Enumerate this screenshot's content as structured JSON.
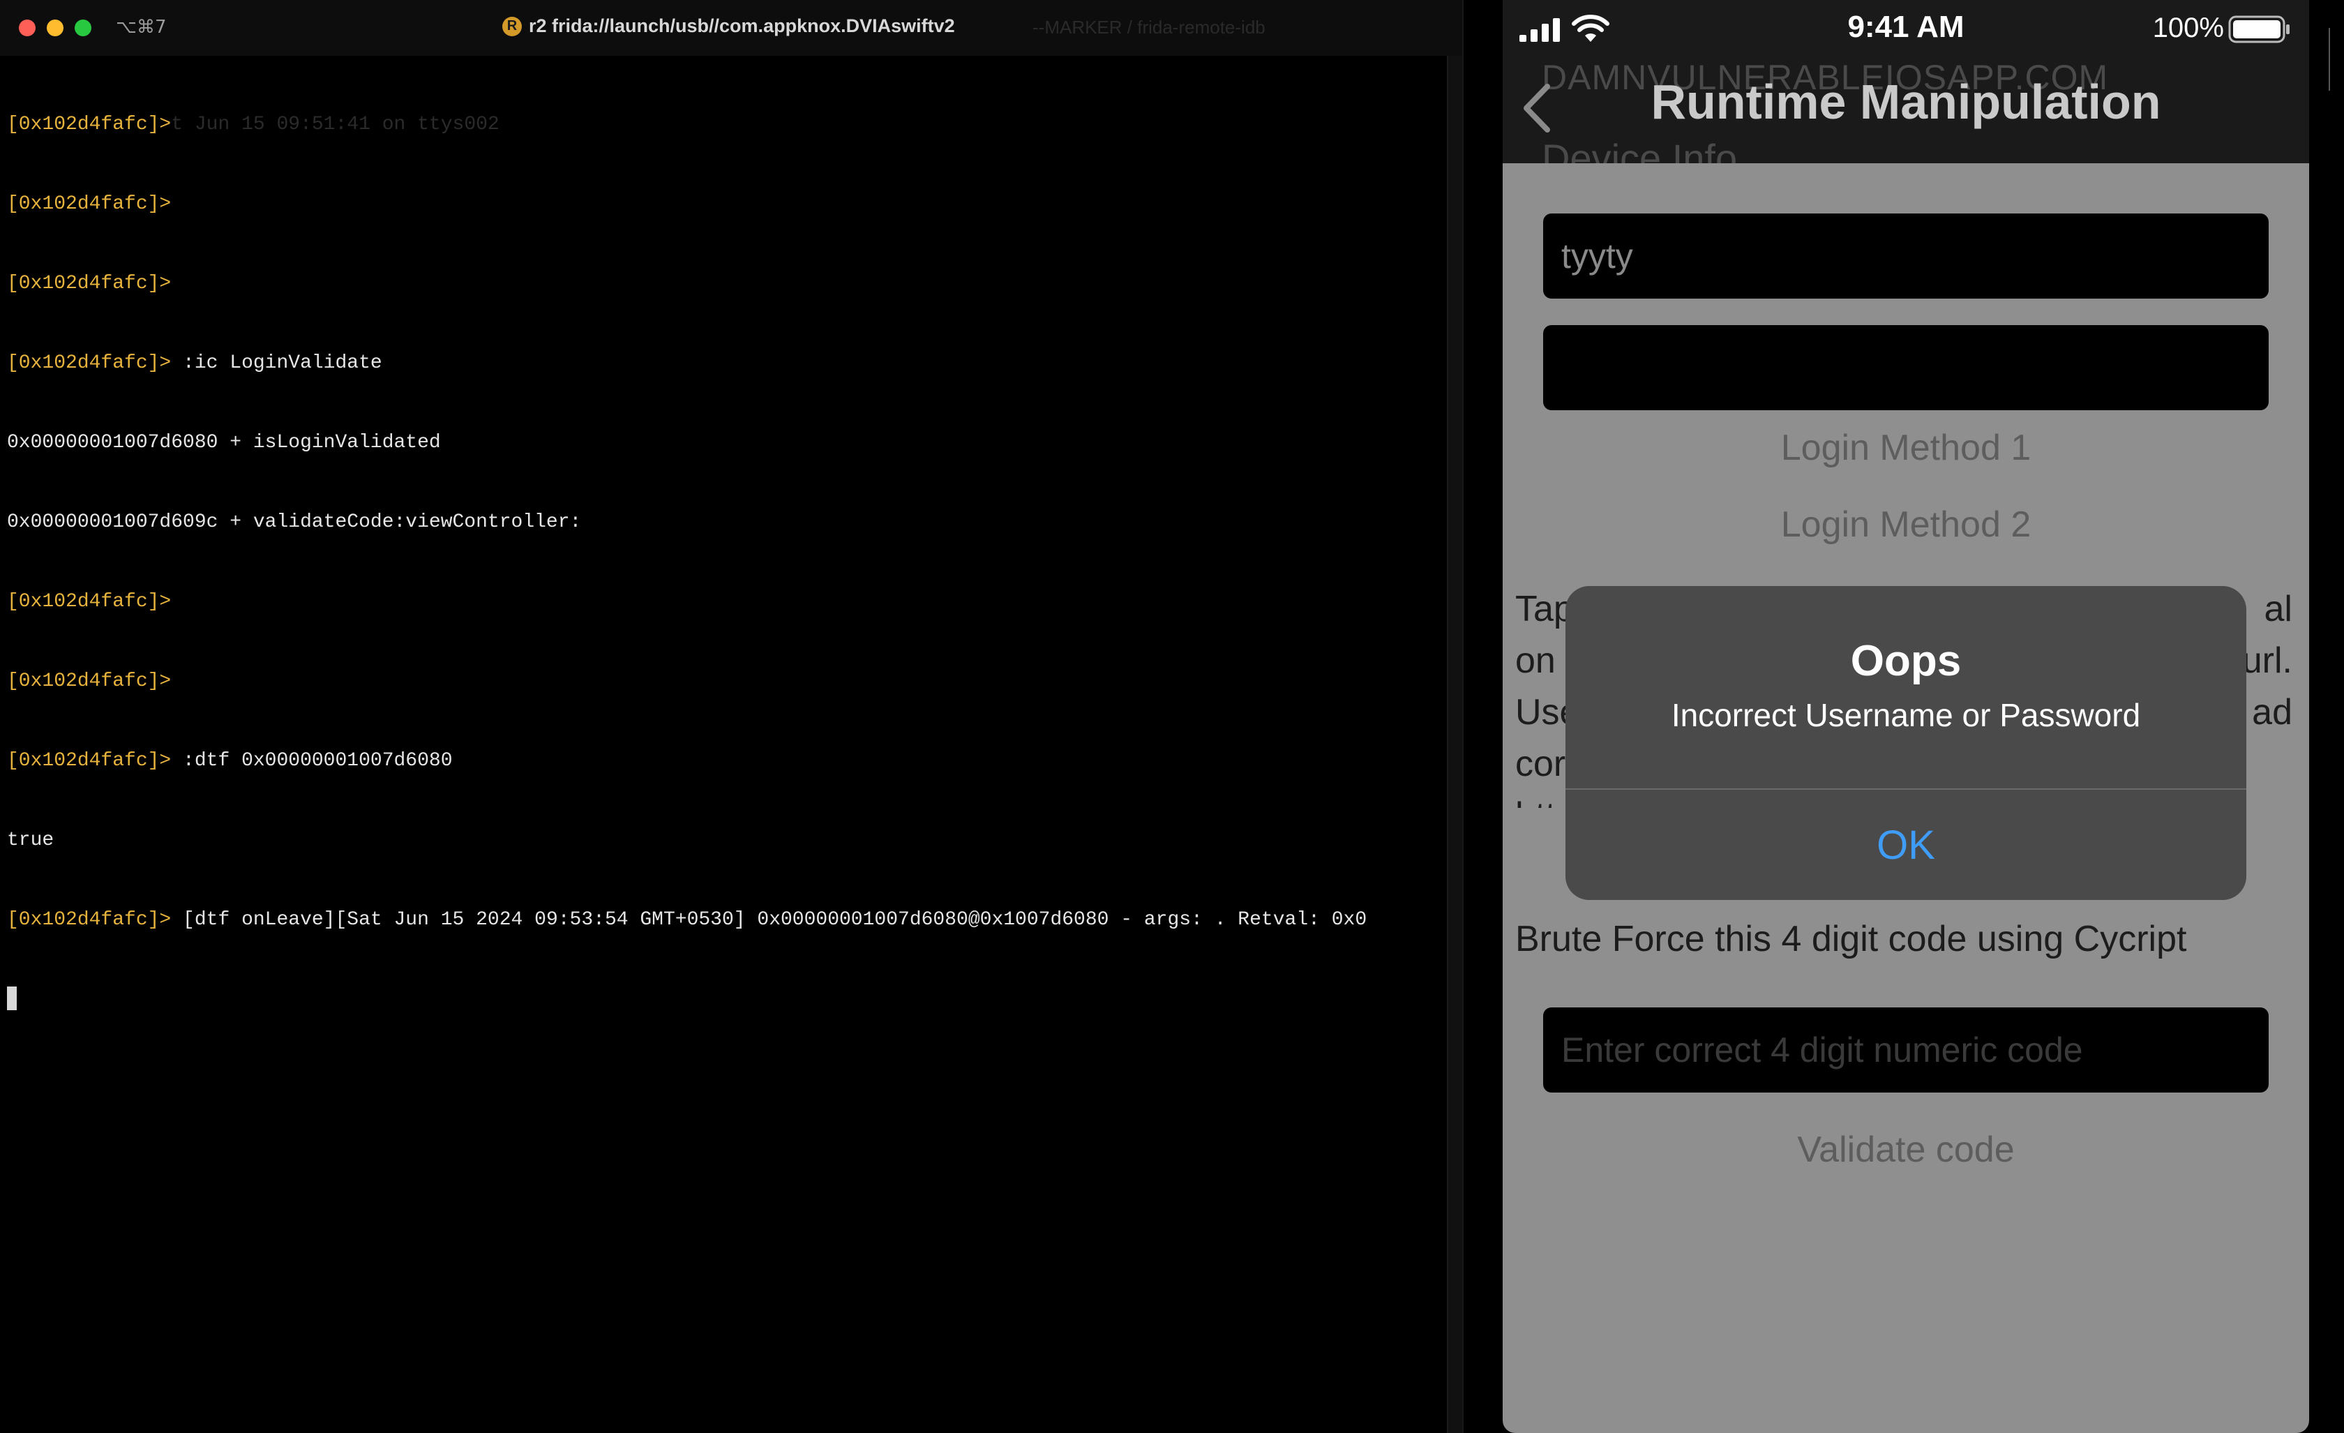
{
  "terminal": {
    "shortcut": "⌥⌘7",
    "title": "r2 frida://launch/usb//com.appknox.DVIAswiftv2",
    "title_ghost": "--MARKER / frida-remote-idb",
    "lines": [
      {
        "prompt": "[0x102d4fafc]>",
        "text": "",
        "ghost": "t Jun 15 09:51:41 on ttys002"
      },
      {
        "prompt": "[0x102d4fafc]>",
        "text": "",
        "ghost": ""
      },
      {
        "prompt": "[0x102d4fafc]>",
        "text": "",
        "ghost": ""
      },
      {
        "prompt": "[0x102d4fafc]>",
        "text": " :ic LoginValidate",
        "ghost": ""
      },
      {
        "prompt": "",
        "text": "0x00000001007d6080 + isLoginValidated",
        "ghost": ""
      },
      {
        "prompt": "",
        "text": "0x00000001007d609c + validateCode:viewController:",
        "ghost": ""
      },
      {
        "prompt": "[0x102d4fafc]>",
        "text": "",
        "ghost": ""
      },
      {
        "prompt": "[0x102d4fafc]>",
        "text": "",
        "ghost": ""
      },
      {
        "prompt": "[0x102d4fafc]>",
        "text": " :dtf 0x00000001007d6080",
        "ghost": ""
      },
      {
        "prompt": "",
        "text": "true",
        "ghost": ""
      },
      {
        "prompt": "[0x102d4fafc]>",
        "text": " [dtf onLeave][Sat Jun 15 2024 09:53:54 GMT+0530] 0x00000001007d6080@0x1007d6080 - args: . Retval: 0x0",
        "ghost": ""
      }
    ]
  },
  "phone": {
    "status": {
      "time": "9:41 AM",
      "battery": "100%"
    },
    "nav": {
      "domain": "DAMNVULNERABLEIOSAPP.COM",
      "title": "Runtime Manipulation",
      "sub": "Device Info"
    },
    "username_value": "tyyty",
    "password_value": "",
    "login1": "Login Method 1",
    "login2": "Login Method 2",
    "bg_text_left": [
      "Tap",
      "on",
      "Use",
      "cor",
      "htt"
    ],
    "bg_text_right": [
      "al",
      "url.",
      "ad"
    ],
    "brute_label": "Brute Force this 4 digit code using Cycript",
    "code_placeholder": "Enter correct 4 digit numeric code",
    "validate": "Validate code",
    "alert": {
      "title": "Oops",
      "message": "Incorrect Username or Password",
      "ok": "OK"
    }
  },
  "colors": {
    "prompt": "#e7b33c",
    "alert_ok": "#3f9df7",
    "close": "#ff5f57",
    "minimize": "#febc2e",
    "maximize": "#28c840"
  }
}
